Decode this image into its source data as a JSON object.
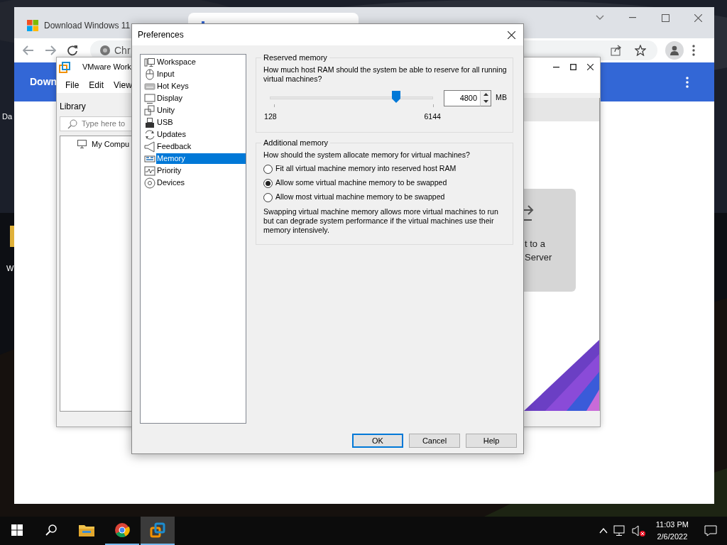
{
  "desktop": {
    "icon_labels": [
      "Da",
      "W"
    ]
  },
  "browser": {
    "tabs": [
      {
        "title": "Download Windows 11",
        "selected": false
      },
      {
        "selected": true
      }
    ],
    "address": "Chr",
    "page": {
      "header_title": "Down"
    }
  },
  "vmware": {
    "title": "VMware Work",
    "menu": [
      "File",
      "Edit",
      "View"
    ],
    "library": {
      "title": "Library",
      "search_placeholder": "Type here to",
      "tree": [
        {
          "label": "My Compu"
        }
      ]
    },
    "home_card": {
      "lines": [
        "t to a",
        "Server"
      ]
    }
  },
  "dialog": {
    "title": "Preferences",
    "categories": [
      {
        "label": "Workspace",
        "selected": false
      },
      {
        "label": "Input",
        "selected": false
      },
      {
        "label": "Hot Keys",
        "selected": false
      },
      {
        "label": "Display",
        "selected": false
      },
      {
        "label": "Unity",
        "selected": false
      },
      {
        "label": "USB",
        "selected": false
      },
      {
        "label": "Updates",
        "selected": false
      },
      {
        "label": "Feedback",
        "selected": false
      },
      {
        "label": "Memory",
        "selected": true
      },
      {
        "label": "Priority",
        "selected": false
      },
      {
        "label": "Devices",
        "selected": false
      }
    ],
    "reserved_memory": {
      "title": "Reserved memory",
      "question": "How much host RAM should the system be able to reserve for all running virtual machines?",
      "level": 0.77,
      "min_label": "128",
      "max_label": "6144",
      "value": "4800",
      "unit": "MB"
    },
    "additional_memory": {
      "title": "Additional memory",
      "question": "How should the system allocate memory for virtual machines?",
      "options": [
        {
          "label": "Fit all virtual machine memory into reserved host RAM",
          "selected": false
        },
        {
          "label": "Allow some virtual machine memory to be swapped",
          "selected": true
        },
        {
          "label": "Allow most virtual machine memory to be swapped",
          "selected": false
        }
      ],
      "note": "Swapping virtual machine memory allows more virtual machines to run but can degrade system performance if the virtual machines use their memory intensively."
    },
    "buttons": [
      {
        "label": "OK",
        "default": true
      },
      {
        "label": "Cancel",
        "default": false
      },
      {
        "label": "Help",
        "default": false
      }
    ]
  },
  "taskbar": {
    "apps": [
      {
        "kind": "explorer",
        "running": false,
        "selected": false
      },
      {
        "kind": "browser",
        "running": true,
        "selected": false
      },
      {
        "kind": "vmware",
        "running": true,
        "selected": true
      }
    ],
    "time": "11:03 PM",
    "date": "2/6/2022"
  }
}
